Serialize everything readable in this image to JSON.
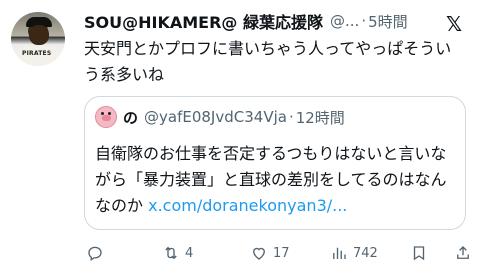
{
  "author": {
    "name": "SOU@HIKAMER@ 緑葉応援隊",
    "handle": "@...",
    "separator": "·",
    "time": "5時間",
    "avatar_text": "PIRATES"
  },
  "post_text": "天安門とかプロフに書いちゃう人ってやっぱそういう系多いね",
  "quoted": {
    "name": "の",
    "handle": "@yafE08JvdC34Vja",
    "separator": "·",
    "time": "12時間",
    "text": "自衛隊のお仕事を否定するつもりはないと言いながら「暴力装置」と直球の差別をしてるのはなんなのか ",
    "link": "x.com/doranekonyan3/..."
  },
  "actions": {
    "replies": "",
    "reposts": "4",
    "likes": "17",
    "views": "742"
  },
  "icons": [
    "x-logo-icon",
    "reply-icon",
    "repost-icon",
    "like-icon",
    "views-icon",
    "bookmark-icon",
    "share-icon"
  ],
  "colors": {
    "link": "#1d9bf0",
    "muted": "#536471",
    "text": "#0f1419",
    "border": "#cfd9de"
  }
}
